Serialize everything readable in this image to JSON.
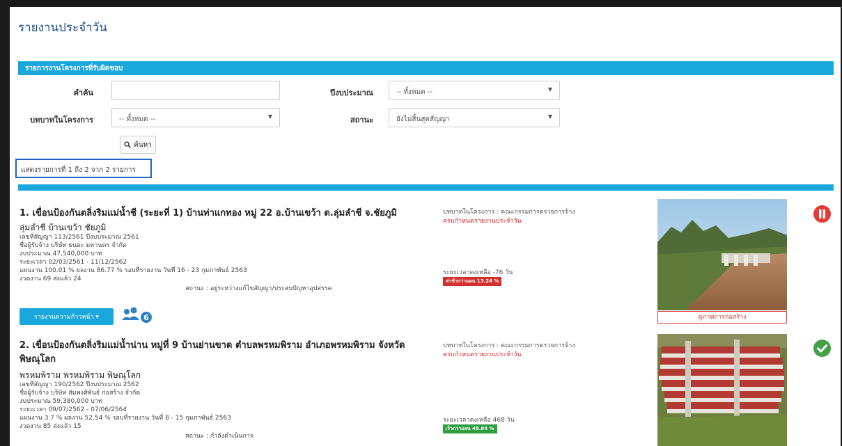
{
  "page": {
    "title": "รายงานประจำวัน"
  },
  "filter": {
    "section_title": "รายการงานโครงการที่รับผิดชอบ",
    "keyword_label": "คำค้น",
    "keyword_value": "",
    "budget_year_label": "ปีงบประมาณ",
    "budget_year_value": "-- ทั้งหมด --",
    "role_label": "บทบาทในโครงการ",
    "role_value": "-- ทั้งหมด --",
    "status_label": "สถานะ",
    "status_value": "ยังไม่สิ้นสุดสัญญา",
    "search_label": "ค้นหา"
  },
  "results": {
    "count_text": "แสดงรายการที่ 1 ถึง 2 จาก 2 รายการ"
  },
  "projects": [
    {
      "title": "1. เขื่อนป้องกันตลิ่งริมแม่น้ำชี (ระยะที่ 1) บ้านท่าแกทอง หมู่ 22 อ.บ้านเขว้า ต.ลุ่มลำชี จ.ชัยภูมิ",
      "location": "ลุ่มลำชี บ้านเขว้า ชัยภูมิ",
      "contract": "เลขที่สัญญา 113/2561 ปีงบประมาณ 2561",
      "contractor": "ชื่อผู้รับจ้าง บริษัท ธนดะ มหานคร จำกัด",
      "budget": "งบประมาณ 47,540,000 บาท",
      "period": "ระยะเวลา 02/03/2561 - 11/12/2562",
      "progress": "แผนงาน 100.01 % ผลงาน 86.77 % รอบที่รายงาน วันที่ 16 - 23 กุมภาพันธ์ 2563",
      "installments": "งวดงาน 69 ส่งแล้ว 24",
      "status": "สถานะ : อยู่ระหว่างแก้ไขสัญญา/ประสบปัญหาอุปสรรค",
      "role": "บทบาทในโครงการ : คณะกรรมการตรวจการจ้าง",
      "alert": "ครบกำหนดรายงานประจำวัน",
      "remaining": "ระยะเวลาคงเหลือ -76 วัน",
      "badge": "ล่าช้ากว่าแผน 13.24 %",
      "badge_color": "#d32f2f",
      "report_button": "รายงานความก้าวหน้า ▾",
      "people_count": "6",
      "photo_caption": "ดูภาพการก่อสร้าง",
      "status_icon": "pause-icon",
      "status_color": "#e53935"
    },
    {
      "title": "2. เขื่อนป้องกันตลิ่งริมแม่น้ำน่าน หมู่ที่ 9 บ้านย่านขาด ตำบลพรหมพิราม อำเภอพรหมพิราม จังหวัดพิษณุโลก",
      "location": "พรหมพิราม พรหมพิราม พิษณุโลก",
      "contract": "เลขที่สัญญา 190/2562 ปีงบประมาณ 2562",
      "contractor": "ชื่อผู้รับจ้าง บริษัท สัมพงศ์พันธ์ ก่อสร้าง จำกัด",
      "budget": "งบประมาณ 59,380,000 บาท",
      "period": "ระยะเวลา 09/07/2562 - 07/06/2564",
      "progress": "แผนงาน 3.7 % ผลงาน 52.54 % รอบที่รายงาน วันที่ 8 - 15 กุมภาพันธ์ 2563",
      "installments": "งวดงาน 85 ส่งแล้ว 15",
      "status": "สถานะ : กำลังดำเนินการ",
      "role": "บทบาทในโครงการ : คณะกรรมการตรวจการจ้าง",
      "alert": "ครบกำหนดรายงานประจำวัน",
      "remaining": "ระยะเวลาคงเหลือ 468 วัน",
      "badge": "เร็วกว่าแผน 48.84 %",
      "badge_color": "#2e9e3e",
      "status_icon": "check-icon",
      "status_color": "#43a047"
    }
  ]
}
